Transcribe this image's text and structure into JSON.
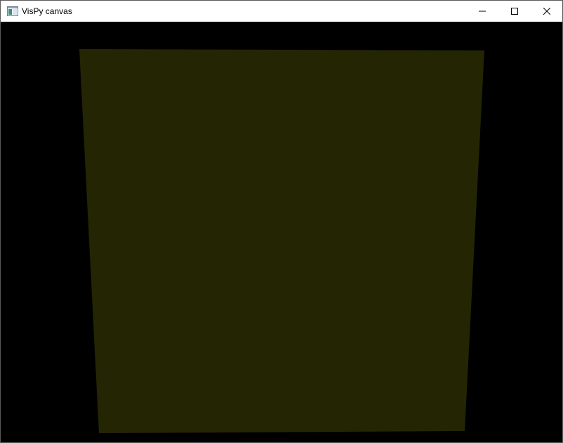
{
  "window": {
    "title": "VisPy canvas",
    "buttons": {
      "minimize": "minimize-icon",
      "maximize": "maximize-icon",
      "close": "close-icon"
    }
  },
  "canvas": {
    "background_color": "#000000",
    "quad_color": "#242603"
  }
}
